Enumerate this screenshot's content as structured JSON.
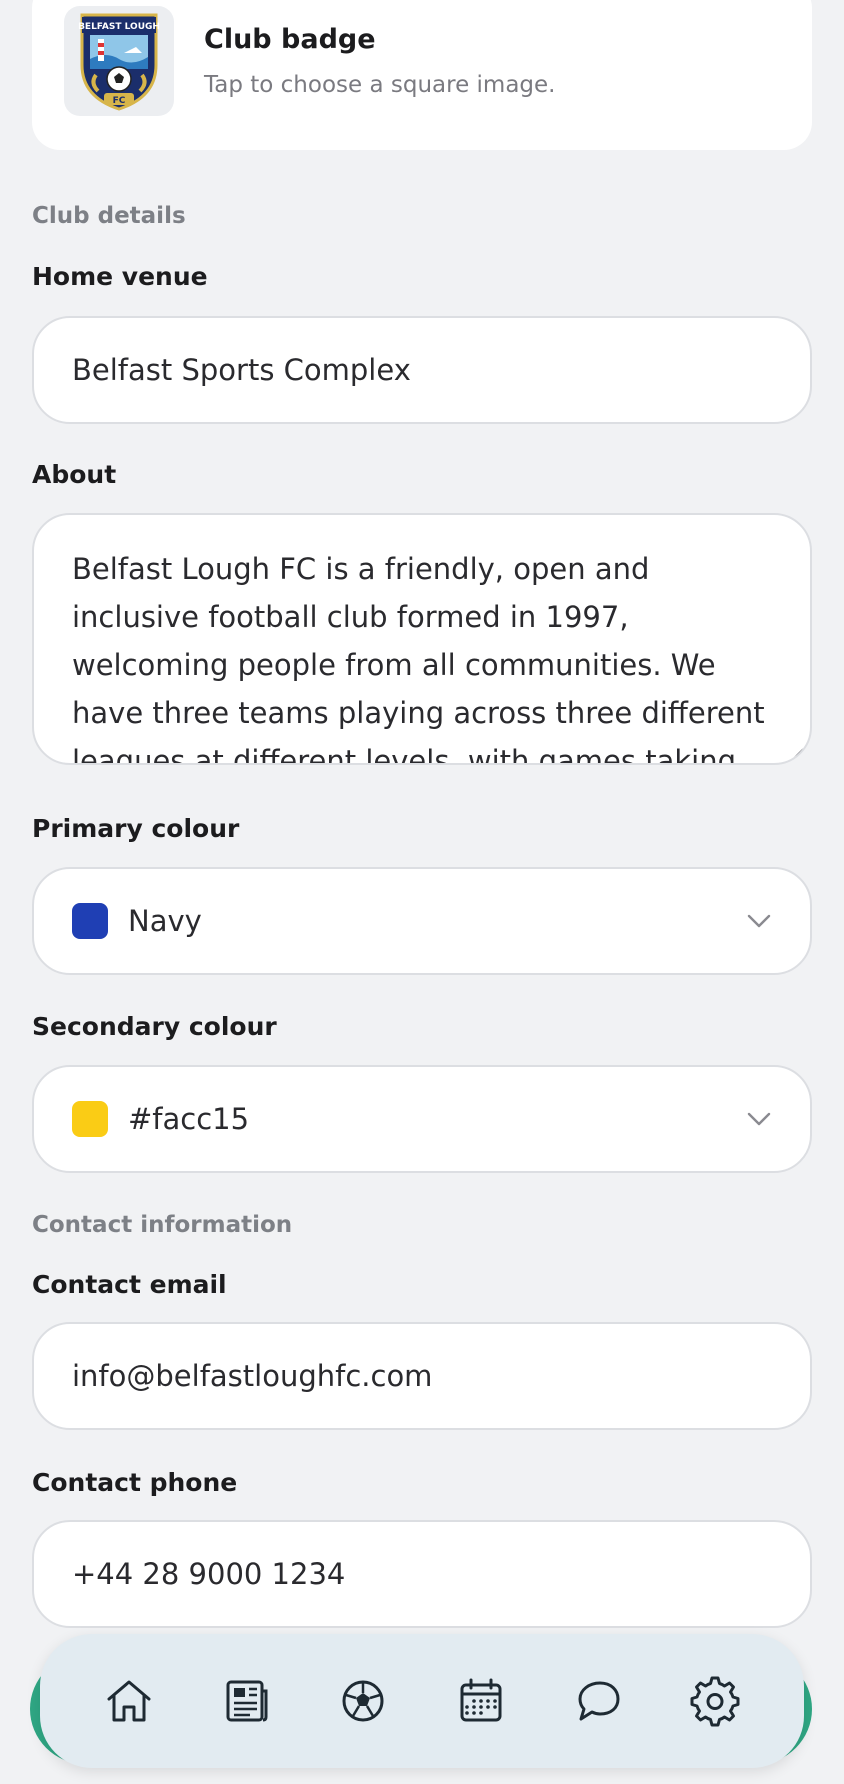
{
  "badge": {
    "title": "Club badge",
    "subtitle": "Tap to choose a square image.",
    "crest_text_top": "BELFAST LOUGH",
    "crest_text_bottom": "FC"
  },
  "sections": {
    "club_details": "Club details",
    "contact_information": "Contact information"
  },
  "home_venue": {
    "label": "Home venue",
    "value": "Belfast Sports Complex"
  },
  "about": {
    "label": "About",
    "value": "Belfast Lough FC is a friendly, open and inclusive football club formed in 1997, welcoming people from all communities. We have three teams playing across three different leagues at different levels, with games taking place in Belfast and the"
  },
  "primary_colour": {
    "label": "Primary colour",
    "value": "Navy",
    "swatch": "#1f3fb4"
  },
  "secondary_colour": {
    "label": "Secondary colour",
    "value": "#facc15",
    "swatch": "#facc15"
  },
  "contact_email": {
    "label": "Contact email",
    "value": "info@belfastloughfc.com"
  },
  "contact_phone": {
    "label": "Contact phone",
    "value": "+44 28 9000 1234"
  },
  "nav": {
    "items": [
      "home-icon",
      "news-icon",
      "football-icon",
      "calendar-icon",
      "chat-icon",
      "gear-icon"
    ]
  },
  "colors": {
    "background": "#f1f2f4",
    "nav_background": "#e2ebf1",
    "accent": "#2fa784"
  }
}
